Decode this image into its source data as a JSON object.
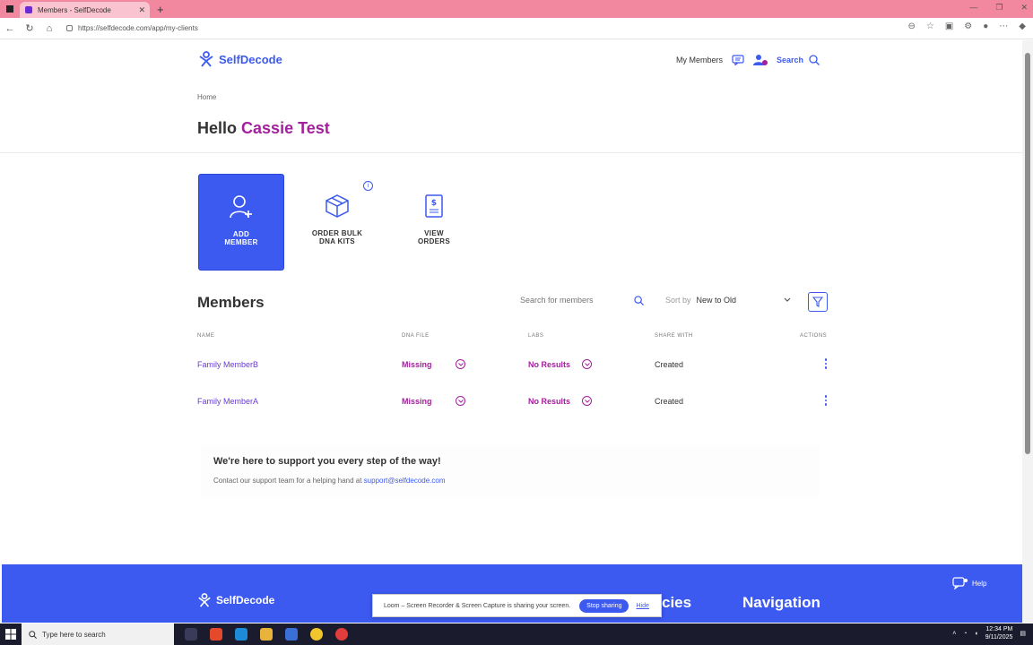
{
  "browser": {
    "tab_title": "Members - SelfDecode",
    "tab_close": "✕",
    "new_tab": "+",
    "url": "https://selfdecode.com/app/my-clients"
  },
  "header": {
    "brand": "SelfDecode",
    "my_members": "My Members",
    "search": "Search"
  },
  "breadcrumb": "Home",
  "greeting": {
    "hello": "Hello",
    "name": "Cassie Test"
  },
  "actions": [
    {
      "line1": "ADD",
      "line2": "MEMBER"
    },
    {
      "line1": "ORDER BULK",
      "line2": "DNA KITS"
    },
    {
      "line1": "VIEW",
      "line2": "ORDERS"
    }
  ],
  "members": {
    "title": "Members",
    "search_placeholder": "Search for members",
    "sort_label": "Sort by",
    "sort_value": "New to Old",
    "columns": [
      "NAME",
      "DNA FILE",
      "LABS",
      "SHARE WITH",
      "ACTIONS"
    ],
    "rows": [
      {
        "name": "Family MemberB",
        "dna": "Missing",
        "labs": "No Results",
        "share": "Created"
      },
      {
        "name": "Family MemberA",
        "dna": "Missing",
        "labs": "No Results",
        "share": "Created"
      }
    ]
  },
  "support": {
    "title": "We're here to support you every step of the way!",
    "text": "Contact our support team for a helping hand at",
    "email": "support@selfdecode.com"
  },
  "footer": {
    "brand": "SelfDecode",
    "col1": "cies",
    "col2": "Navigation",
    "help": "Help"
  },
  "loom": {
    "message": "Loom – Screen Recorder & Screen Capture is sharing your screen.",
    "stop": "Stop sharing",
    "hide": "Hide"
  },
  "taskbar": {
    "search_placeholder": "Type here to search",
    "time": "12:34 PM",
    "date": "9/11/2025"
  },
  "colors": {
    "brand_blue": "#3c59f0",
    "accent_purple": "#a3219c",
    "tab_pink": "#f1889f"
  }
}
